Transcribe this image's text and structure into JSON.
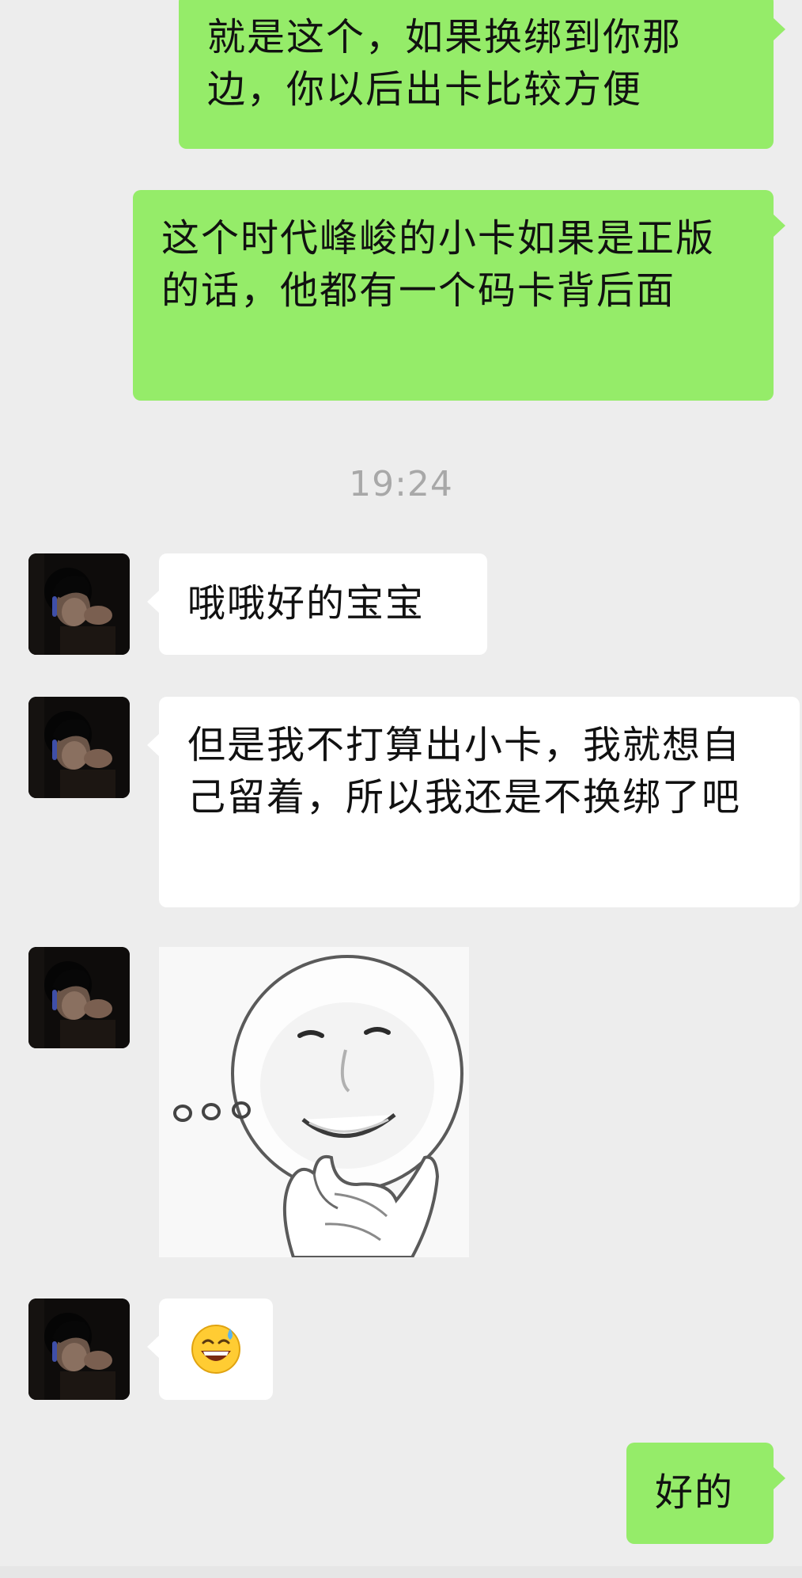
{
  "chat": {
    "messages": {
      "m1": {
        "sender": "me",
        "text": "就是这个，如果换绑到你那边，你以后出卡比较方便"
      },
      "m2": {
        "sender": "me",
        "text": "这个时代峰峻的小卡如果是正版的话，他都有一个码卡背后面"
      },
      "m3": {
        "sender": "contact",
        "text": "哦哦好的宝宝"
      },
      "m4": {
        "sender": "contact",
        "text": "但是我不打算出小卡，我就想自己留着，所以我还是不换绑了吧"
      },
      "m5": {
        "sender": "contact",
        "type": "sticker",
        "icon": "thinking-thumb-chin-face-sticker",
        "text": "..."
      },
      "m6": {
        "sender": "contact",
        "type": "emoji",
        "icon": "grinning-face-with-sweat",
        "text": "😅"
      },
      "m7": {
        "sender": "me",
        "text": "好的"
      }
    },
    "timestamp": "19:24"
  },
  "colors": {
    "background": "#ededed",
    "outgoing_bubble": "#95ec69",
    "incoming_bubble": "#ffffff",
    "timestamp": "#a8a8a8"
  }
}
